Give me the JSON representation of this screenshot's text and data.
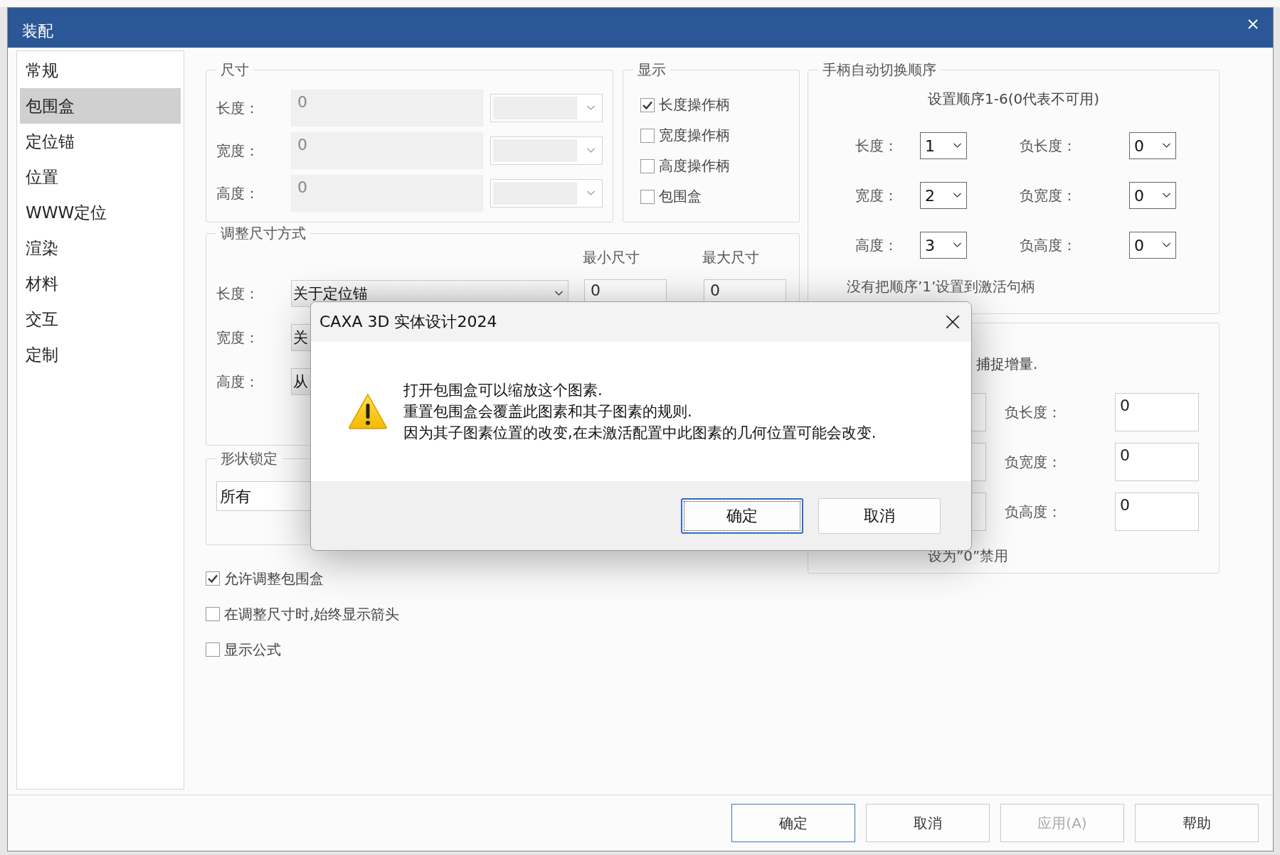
{
  "window": {
    "title": "装配"
  },
  "sidebar": {
    "items": [
      {
        "label": "常规",
        "selected": false
      },
      {
        "label": "包围盒",
        "selected": true
      },
      {
        "label": "定位锚",
        "selected": false
      },
      {
        "label": "位置",
        "selected": false
      },
      {
        "label": "WWW定位",
        "selected": false
      },
      {
        "label": "渲染",
        "selected": false
      },
      {
        "label": "材料",
        "selected": false
      },
      {
        "label": "交互",
        "selected": false
      },
      {
        "label": "定制",
        "selected": false
      }
    ]
  },
  "size_group": {
    "title": "尺寸",
    "rows": [
      {
        "label": "长度：",
        "value": "0",
        "disabled": true
      },
      {
        "label": "宽度：",
        "value": "0",
        "disabled": true
      },
      {
        "label": "高度：",
        "value": "0",
        "disabled": true
      }
    ]
  },
  "display_group": {
    "title": "显示",
    "options": [
      {
        "label": "长度操作柄",
        "checked": true
      },
      {
        "label": "宽度操作柄",
        "checked": false
      },
      {
        "label": "高度操作柄",
        "checked": false
      },
      {
        "label": "包围盒",
        "checked": false
      }
    ]
  },
  "handle_order": {
    "title": "手柄自动切换顺序",
    "hint": "设置顺序1-6(0代表不可用)",
    "rows": [
      {
        "label": "长度：",
        "value": "1",
        "neg_label": "负长度：",
        "neg_value": "0"
      },
      {
        "label": "宽度：",
        "value": "2",
        "neg_label": "负宽度：",
        "neg_value": "0"
      },
      {
        "label": "高度：",
        "value": "3",
        "neg_label": "负高度：",
        "neg_value": "0"
      }
    ],
    "note": "没有把顺序’1’设置到激活句柄"
  },
  "resize_group": {
    "title": "调整尺寸方式",
    "min_header": "最小尺寸",
    "max_header": "最大尺寸",
    "rows": [
      {
        "label": "长度：",
        "value": "关于定位锚",
        "min": "0",
        "max": "0"
      },
      {
        "label": "宽度：",
        "value": "关"
      },
      {
        "label": "高度：",
        "value": "从"
      }
    ]
  },
  "shape_lock": {
    "title": "形状锁定",
    "value": "所有"
  },
  "snap_group": {
    "caption": "捕捉增量.",
    "rows": [
      {
        "label": "负长度：",
        "value": "0"
      },
      {
        "label": "负宽度：",
        "value": "0"
      },
      {
        "label": "负高度：",
        "value": "0"
      }
    ],
    "note": "设为”0”禁用"
  },
  "options": [
    {
      "label": "允许调整包围盒",
      "checked": true
    },
    {
      "label": "在调整尺寸时,始终显示箭头",
      "checked": false
    },
    {
      "label": "显示公式",
      "checked": false
    }
  ],
  "buttons": [
    {
      "label": "确定",
      "disabled": false
    },
    {
      "label": "取消",
      "disabled": false
    },
    {
      "label": "应用(A)",
      "disabled": true
    },
    {
      "label": "帮助",
      "disabled": false
    }
  ],
  "message_box": {
    "title": "CAXA 3D 实体设计2024",
    "lines": [
      "打开包围盒可以缩放这个图素.",
      "重置包围盒会覆盖此图素和其子图素的规则.",
      "因为其子图素位置的改变,在未激活配置中此图素的几何位置可能会改变."
    ],
    "buttons": [
      {
        "label": "确定",
        "default": true
      },
      {
        "label": "取消",
        "default": false
      }
    ]
  }
}
